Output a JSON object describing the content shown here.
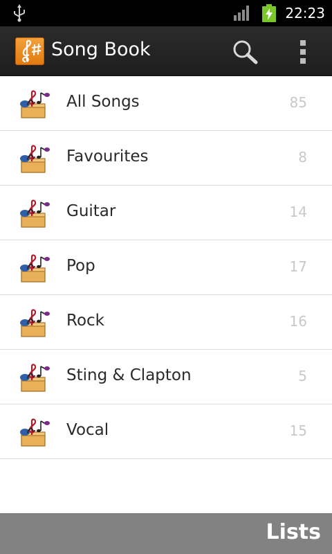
{
  "status_bar": {
    "time": "22:23",
    "icons": [
      "usb-icon",
      "signal-icon",
      "battery-charging-icon"
    ]
  },
  "action_bar": {
    "app_icon": "treble-clef-sharp-icon",
    "title": "Song Book",
    "actions": [
      "search-icon",
      "overflow-menu-icon"
    ]
  },
  "lists": [
    {
      "label": "All Songs",
      "count": "85",
      "icon": "song-list-folder-icon"
    },
    {
      "label": "Favourites",
      "count": "8",
      "icon": "song-list-folder-icon"
    },
    {
      "label": "Guitar",
      "count": "14",
      "icon": "song-list-folder-icon"
    },
    {
      "label": "Pop",
      "count": "17",
      "icon": "song-list-folder-icon"
    },
    {
      "label": "Rock",
      "count": "16",
      "icon": "song-list-folder-icon"
    },
    {
      "label": "Sting & Clapton",
      "count": "5",
      "icon": "song-list-folder-icon"
    },
    {
      "label": "Vocal",
      "count": "15",
      "icon": "song-list-folder-icon"
    }
  ],
  "bottom_bar": {
    "title": "Lists"
  },
  "colors": {
    "status_bar_bg": "#000000",
    "action_bar_bg": "#222222",
    "app_icon_orange": "#ee8c20",
    "count_text": "#c8c8c8",
    "bottom_bar_bg": "#828282",
    "battery_green": "#7bc62d"
  }
}
